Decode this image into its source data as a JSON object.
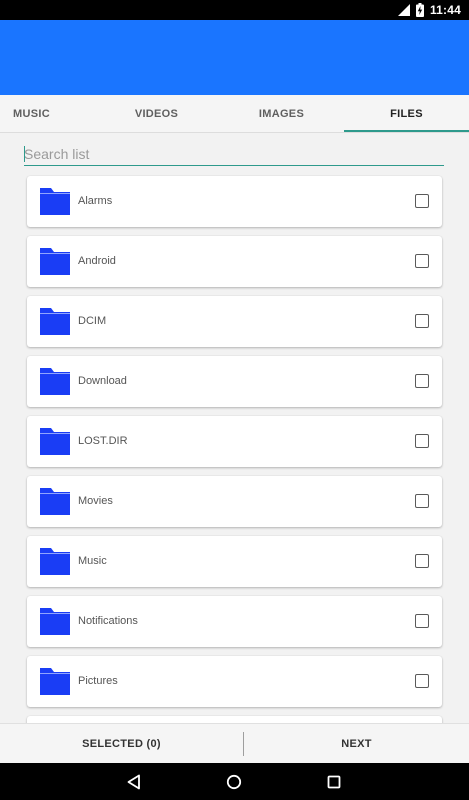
{
  "status_bar": {
    "time": "11:44",
    "icons": [
      "signal-icon",
      "battery-charging-icon"
    ]
  },
  "app_bar": {
    "color": "#1a75ff"
  },
  "tabs": [
    {
      "label": "MUSIC",
      "active": false
    },
    {
      "label": "VIDEOS",
      "active": false
    },
    {
      "label": "IMAGES",
      "active": false
    },
    {
      "label": "FILES",
      "active": true
    }
  ],
  "search": {
    "placeholder": "Search list",
    "value": ""
  },
  "files": [
    {
      "name": "Alarms",
      "checked": false
    },
    {
      "name": "Android",
      "checked": false
    },
    {
      "name": "DCIM",
      "checked": false
    },
    {
      "name": "Download",
      "checked": false
    },
    {
      "name": "LOST.DIR",
      "checked": false
    },
    {
      "name": "Movies",
      "checked": false
    },
    {
      "name": "Music",
      "checked": false
    },
    {
      "name": "Notifications",
      "checked": false
    },
    {
      "name": "Pictures",
      "checked": false
    }
  ],
  "bottom_bar": {
    "selected_label": "SELECTED (0)",
    "next_label": "NEXT"
  },
  "colors": {
    "accent": "#2e9a8c",
    "folder": "#1a3df5",
    "primary": "#1a75ff"
  },
  "nav_icons": [
    "back-icon",
    "home-icon",
    "recents-icon"
  ]
}
